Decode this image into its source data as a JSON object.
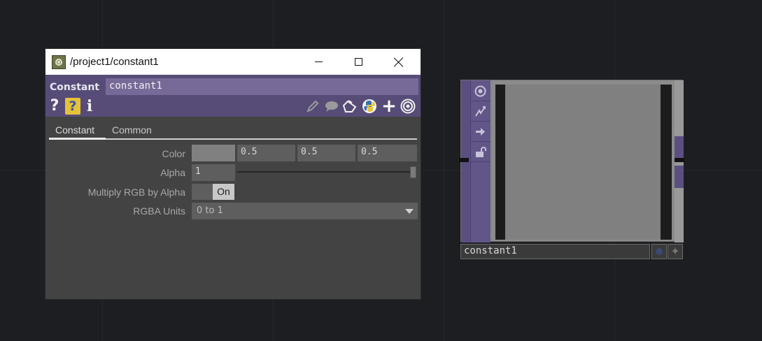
{
  "window": {
    "title": "/project1/constant1"
  },
  "header": {
    "op_type": "Constant",
    "op_name": "constant1",
    "help_glyph": "?",
    "python_help_glyph": "?",
    "info_glyph": "i",
    "left_icons": [
      "help-icon",
      "python-help-icon",
      "info-icon"
    ],
    "right_icons": [
      "pencil-icon",
      "comment-icon",
      "clipboard-icon",
      "python-icon",
      "plus-icon",
      "target-icon"
    ],
    "plus_glyph": "+"
  },
  "tabs": [
    {
      "label": "Constant",
      "active": true
    },
    {
      "label": "Common",
      "active": false
    }
  ],
  "params": {
    "color": {
      "label": "Color",
      "swatch_color": "#808080",
      "values": [
        "0.5",
        "0.5",
        "0.5"
      ]
    },
    "alpha": {
      "label": "Alpha",
      "value": "1",
      "slider_level": 1.0
    },
    "multiply": {
      "label": "Multiply RGB by Alpha",
      "state": "On"
    },
    "units": {
      "label": "RGBA Units",
      "value": "0 to 1"
    }
  },
  "node": {
    "name": "constant1",
    "sidebar_icons": [
      "viewer-icon",
      "bypass-icon",
      "cook-icon",
      "lock-icon"
    ],
    "star_glyph": "✦"
  },
  "colors": {
    "background": "#1d1e22",
    "header_purple": "#574c78",
    "panel": "#434343",
    "node_purple": "#5b4f82"
  }
}
